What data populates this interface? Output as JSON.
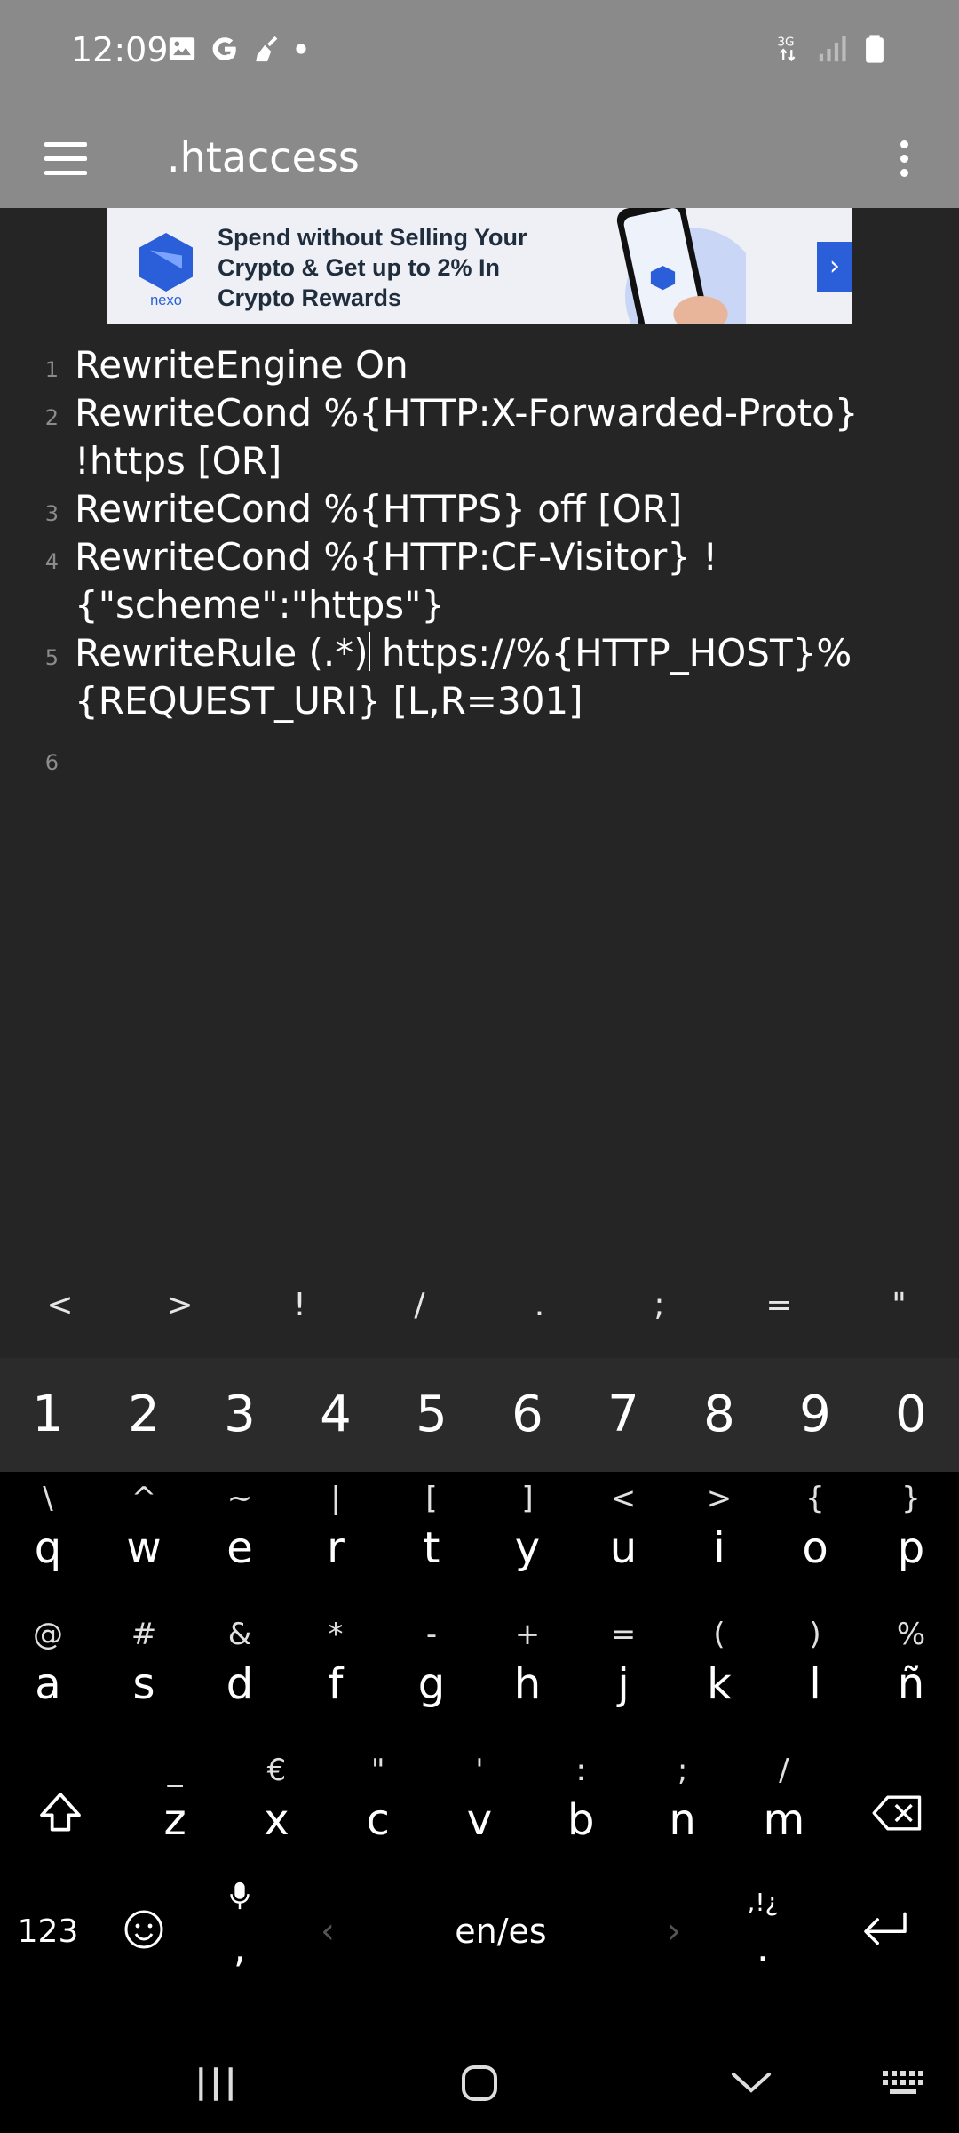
{
  "status_bar": {
    "time": "12:09",
    "left_icons": [
      "image-icon",
      "google-g-icon",
      "broom-icon",
      "dot-icon"
    ],
    "right_icons": [
      "3g-icon",
      "signal-icon",
      "battery-icon"
    ],
    "network": "3G"
  },
  "app_bar": {
    "title": ".htaccess",
    "menu_icon": "hamburger-menu-icon",
    "overflow_icon": "more-vert-icon"
  },
  "ad": {
    "brand": "nexo",
    "text": "Spend without Selling Your Crypto & Get up to 2% In Crypto Rewards",
    "arrow": "›"
  },
  "editor": {
    "lines": [
      {
        "num": "1",
        "text": "RewriteEngine On"
      },
      {
        "num": "2",
        "text": "RewriteCond %{HTTP:X-Forwarded-Proto} !https [OR]"
      },
      {
        "num": "3",
        "text": "RewriteCond %{HTTPS} off [OR]"
      },
      {
        "num": "4",
        "text": "RewriteCond %{HTTP:CF-Visitor} !{\"scheme\":\"https\"}"
      },
      {
        "num": "5",
        "text": "RewriteRule (.*) https://%{HTTP_HOST}%{REQUEST_URI} [L,R=301]"
      },
      {
        "num": "6",
        "text": ""
      }
    ]
  },
  "symbol_bar": [
    "<",
    ">",
    "!",
    "/",
    ".",
    ";",
    "=",
    "\""
  ],
  "keyboard": {
    "number_row": [
      "1",
      "2",
      "3",
      "4",
      "5",
      "6",
      "7",
      "8",
      "9",
      "0"
    ],
    "row1": [
      {
        "alt": "\\",
        "main": "q"
      },
      {
        "alt": "^",
        "main": "w"
      },
      {
        "alt": "~",
        "main": "e"
      },
      {
        "alt": "|",
        "main": "r"
      },
      {
        "alt": "[",
        "main": "t"
      },
      {
        "alt": "]",
        "main": "y"
      },
      {
        "alt": "<",
        "main": "u"
      },
      {
        "alt": ">",
        "main": "i"
      },
      {
        "alt": "{",
        "main": "o"
      },
      {
        "alt": "}",
        "main": "p"
      }
    ],
    "row2": [
      {
        "alt": "@",
        "main": "a"
      },
      {
        "alt": "#",
        "main": "s"
      },
      {
        "alt": "&",
        "main": "d"
      },
      {
        "alt": "*",
        "main": "f"
      },
      {
        "alt": "-",
        "main": "g"
      },
      {
        "alt": "+",
        "main": "h"
      },
      {
        "alt": "=",
        "main": "j"
      },
      {
        "alt": "(",
        "main": "k"
      },
      {
        "alt": ")",
        "main": "l"
      },
      {
        "alt": "%",
        "main": "ñ"
      }
    ],
    "row3": [
      {
        "alt": "_",
        "main": "z"
      },
      {
        "alt": "€",
        "main": "x"
      },
      {
        "alt": "\"",
        "main": "c"
      },
      {
        "alt": "'",
        "main": "v"
      },
      {
        "alt": ":",
        "main": "b"
      },
      {
        "alt": ";",
        "main": "n"
      },
      {
        "alt": "/",
        "main": "m"
      }
    ],
    "bottom": {
      "numbers_label": "123",
      "comma_label": ",",
      "language_label": "en/es",
      "period_label": ".",
      "period_alt": ",!¿"
    }
  },
  "nav_bar": {
    "icons": [
      "recent-apps-icon",
      "home-icon",
      "back-icon",
      "keyboard-toggle-icon"
    ]
  }
}
